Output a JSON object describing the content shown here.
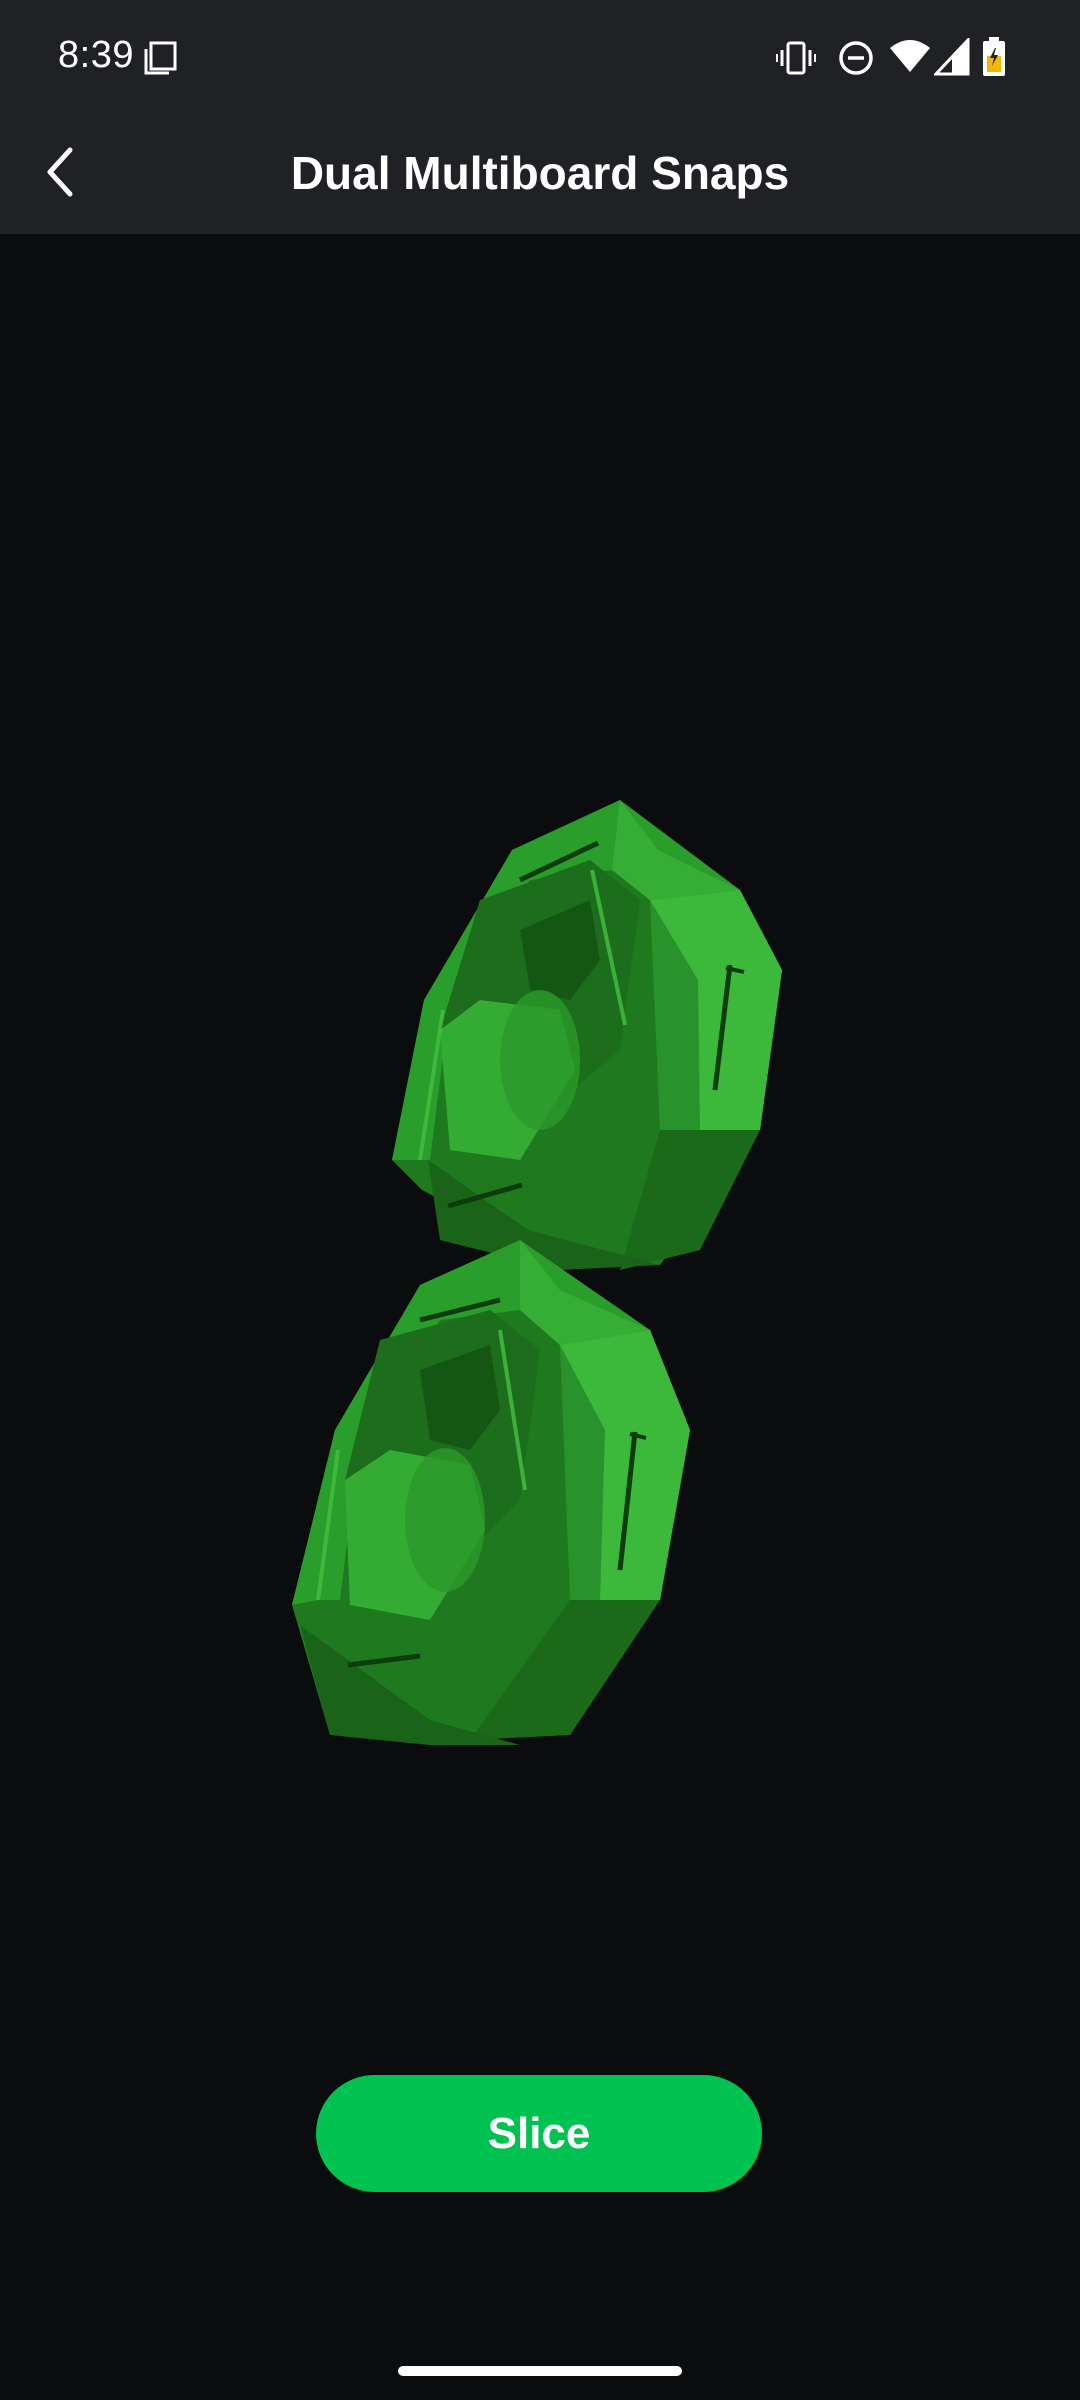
{
  "status_bar": {
    "time": "8:39",
    "icons": [
      "screenshot-notification-icon",
      "vibrate-icon",
      "do-not-disturb-icon",
      "wifi-icon",
      "cell-signal-icon",
      "battery-charging-icon"
    ]
  },
  "app_bar": {
    "title": "Dual Multiboard Snaps",
    "back_icon": "chevron-left-icon"
  },
  "viewer": {
    "model": "3d-model-preview"
  },
  "actions": {
    "slice_label": "Slice"
  },
  "colors": {
    "background": "#0b0c0e",
    "bar_background": "#202124",
    "accent": "#00c250",
    "model_green": "#2e9e2a",
    "battery_charge": "#f2b705"
  }
}
